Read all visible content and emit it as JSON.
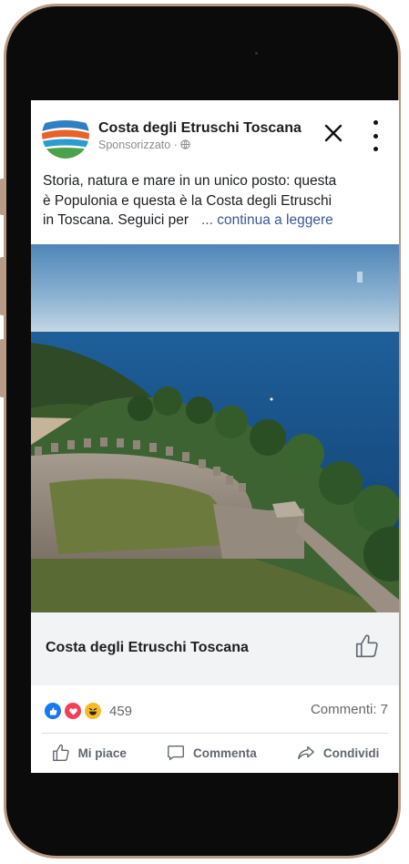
{
  "post": {
    "page_name": "Costa degli Etruschi Toscana",
    "sponsored_label": "Sponsorizzato · ",
    "caption_line1": "Storia, natura e mare in un unico posto: questa",
    "caption_line2": "è Populonia e questa è la Costa degli Etruschi",
    "caption_line3": "in Toscana. Seguici per",
    "more_link": "... continua a leggere"
  },
  "link_preview": {
    "title": "Costa degli Etruschi Toscana"
  },
  "stats": {
    "reaction_count": "459",
    "comments": "Commenti: 7"
  },
  "actions": {
    "like": "Mi piace",
    "comment": "Commenta",
    "share": "Condividi"
  },
  "icons": {
    "close": "close-icon",
    "more": "more-vertical-icon",
    "globe": "globe-icon",
    "like_reaction": "like-reaction-icon",
    "love_reaction": "love-reaction-icon",
    "haha_reaction": "haha-reaction-icon",
    "thumbs_up": "thumbs-up-outline-icon",
    "comment": "comment-icon",
    "share": "share-icon"
  },
  "colors": {
    "link_blue": "#385898",
    "like_blue": "#1877f2",
    "love_red": "#f33e58",
    "haha_yellow": "#f7b928",
    "phone_frame": "#b89b86"
  }
}
